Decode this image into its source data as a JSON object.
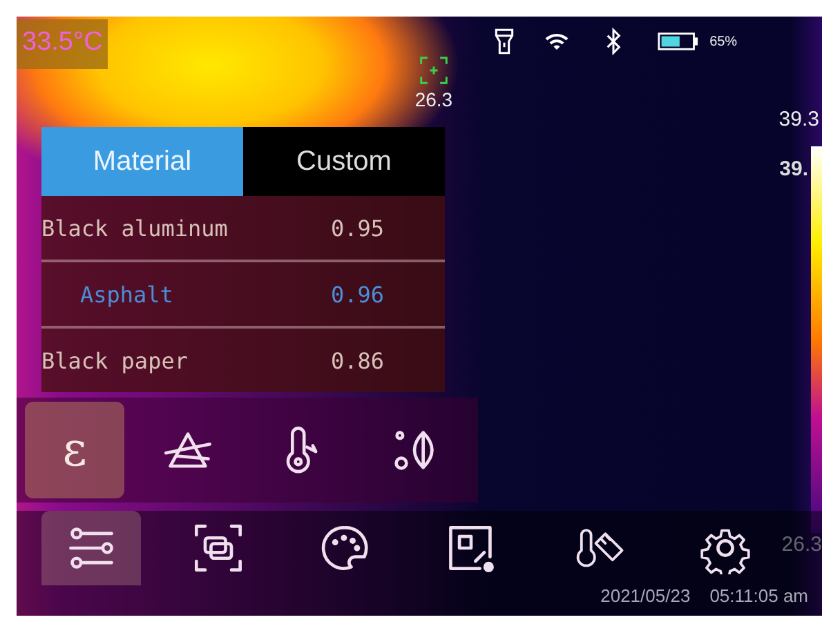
{
  "temperature_badge": "33.5°C",
  "status_bar": {
    "battery_level_text": "65%"
  },
  "spot": {
    "reading": "26.3"
  },
  "scale": {
    "max": "39.3",
    "marker": "39."
  },
  "emissivity_panel": {
    "tabs": [
      {
        "label": "Material",
        "selected": true
      },
      {
        "label": "Custom",
        "selected": false
      }
    ],
    "materials": [
      {
        "name": "Black aluminum",
        "value": "0.95",
        "selected": false
      },
      {
        "name": "Asphalt",
        "value": "0.96",
        "selected": true
      },
      {
        "name": "Black paper",
        "value": "0.86",
        "selected": false
      }
    ]
  },
  "tool_row": [
    {
      "kind": "emissivity",
      "label": "ε",
      "selected": true
    },
    {
      "kind": "prism",
      "selected": false
    },
    {
      "kind": "thermometer",
      "selected": false
    },
    {
      "kind": "humidity",
      "selected": false
    }
  ],
  "toolbar": [
    {
      "kind": "sliders",
      "selected": true
    },
    {
      "kind": "frames",
      "selected": false
    },
    {
      "kind": "palette",
      "selected": false
    },
    {
      "kind": "image",
      "selected": false
    },
    {
      "kind": "measure",
      "selected": false
    },
    {
      "kind": "settings",
      "selected": false
    }
  ],
  "footer": {
    "date": "2021/05/23",
    "time": "05:11:05 am",
    "edge_reading": "26.3"
  }
}
